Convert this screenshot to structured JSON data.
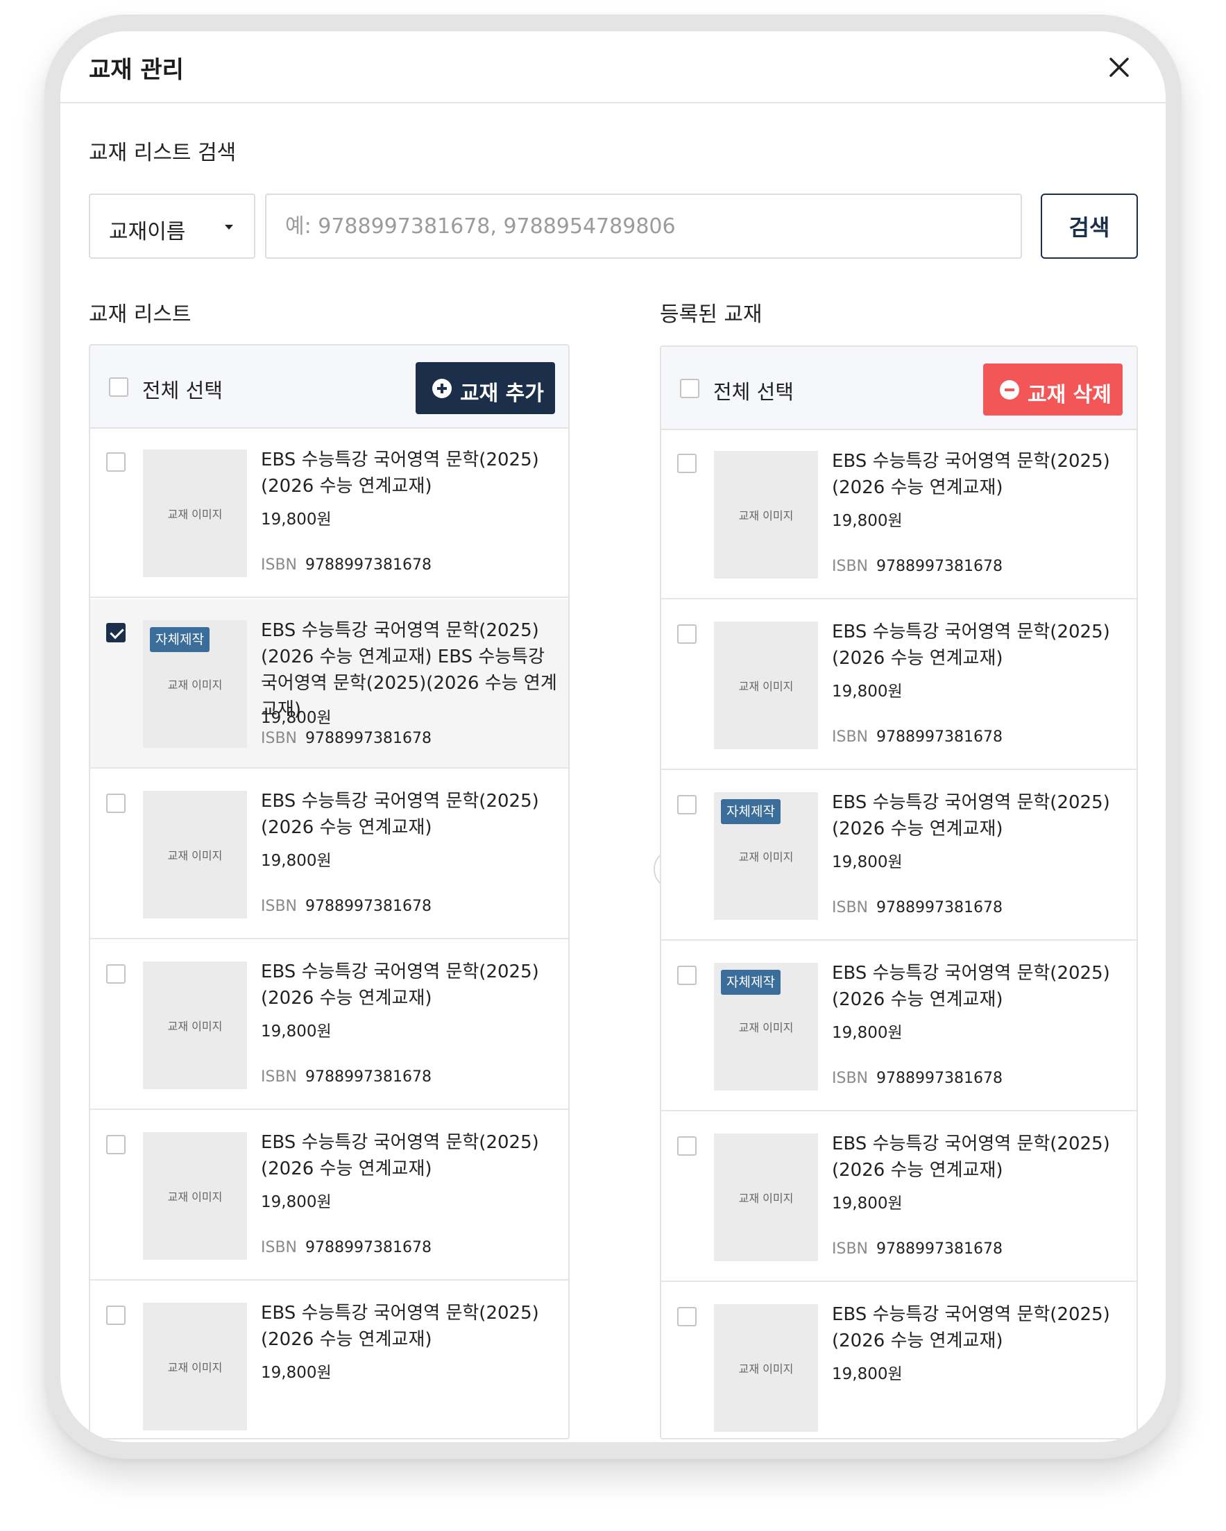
{
  "modal": {
    "title": "교재 관리"
  },
  "search": {
    "section_label": "교재 리스트 검색",
    "select_value": "교재이름",
    "placeholder": "예: 9788997381678, 9788954789806",
    "button_label": "검색"
  },
  "left_panel": {
    "section_label": "교재 리스트",
    "select_all_label": "전체 선택",
    "add_button_label": "교재 추가",
    "items": [
      {
        "title": "EBS 수능특강 국어영역 문학(2025)(2026 수능 연계교재)",
        "price": "19,800원",
        "isbn_label": "ISBN",
        "isbn": "9788997381678",
        "image_text": "교재 이미지",
        "badge": "",
        "checked": false
      },
      {
        "title": "EBS 수능특강 국어영역 문학(2025)(2026 수능 연계교재) EBS 수능특강 국어영역 문학(2025)(2026 수능 연계교재)",
        "price": "19,800원",
        "isbn_label": "ISBN",
        "isbn": "9788997381678",
        "image_text": "교재 이미지",
        "badge": "자체제작",
        "checked": true
      },
      {
        "title": "EBS 수능특강 국어영역 문학(2025)(2026 수능 연계교재)",
        "price": "19,800원",
        "isbn_label": "ISBN",
        "isbn": "9788997381678",
        "image_text": "교재 이미지",
        "badge": "",
        "checked": false
      },
      {
        "title": "EBS 수능특강 국어영역 문학(2025)(2026 수능 연계교재)",
        "price": "19,800원",
        "isbn_label": "ISBN",
        "isbn": "9788997381678",
        "image_text": "교재 이미지",
        "badge": "",
        "checked": false
      },
      {
        "title": "EBS 수능특강 국어영역 문학(2025)(2026 수능 연계교재)",
        "price": "19,800원",
        "isbn_label": "ISBN",
        "isbn": "9788997381678",
        "image_text": "교재 이미지",
        "badge": "",
        "checked": false
      },
      {
        "title": "EBS 수능특강 국어영역 문학(2025)(2026 수능 연계교재)",
        "price": "19,800원",
        "isbn_label": "ISBN",
        "isbn": "",
        "image_text": "교재 이미지",
        "badge": "",
        "checked": false
      }
    ]
  },
  "right_panel": {
    "section_label": "등록된 교재",
    "select_all_label": "전체 선택",
    "delete_button_label": "교재 삭제",
    "items": [
      {
        "title": "EBS 수능특강 국어영역 문학(2025)(2026 수능 연계교재)",
        "price": "19,800원",
        "isbn_label": "ISBN",
        "isbn": "9788997381678",
        "image_text": "교재 이미지",
        "badge": "",
        "checked": false
      },
      {
        "title": "EBS 수능특강 국어영역 문학(2025)(2026 수능 연계교재)",
        "price": "19,800원",
        "isbn_label": "ISBN",
        "isbn": "9788997381678",
        "image_text": "교재 이미지",
        "badge": "",
        "checked": false
      },
      {
        "title": "EBS 수능특강 국어영역 문학(2025)(2026 수능 연계교재)",
        "price": "19,800원",
        "isbn_label": "ISBN",
        "isbn": "9788997381678",
        "image_text": "교재 이미지",
        "badge": "자체제작",
        "checked": false
      },
      {
        "title": "EBS 수능특강 국어영역 문학(2025)(2026 수능 연계교재)",
        "price": "19,800원",
        "isbn_label": "ISBN",
        "isbn": "9788997381678",
        "image_text": "교재 이미지",
        "badge": "자체제작",
        "checked": false
      },
      {
        "title": "EBS 수능특강 국어영역 문학(2025)(2026 수능 연계교재)",
        "price": "19,800원",
        "isbn_label": "ISBN",
        "isbn": "9788997381678",
        "image_text": "교재 이미지",
        "badge": "",
        "checked": false
      },
      {
        "title": "EBS 수능특강 국어영역 문학(2025)(2026 수능 연계교재)",
        "price": "19,800원",
        "isbn_label": "ISBN",
        "isbn": "",
        "image_text": "교재 이미지",
        "badge": "",
        "checked": false
      }
    ]
  },
  "colors": {
    "primary": "#1b2f4a",
    "danger": "#f25656",
    "badge": "#3a6d9a"
  },
  "icons": {
    "close": "close-icon",
    "dropdown": "caret-down-icon",
    "add": "plus-circle-icon",
    "delete": "minus-circle-icon",
    "transfer": "double-chevron-right-icon"
  }
}
